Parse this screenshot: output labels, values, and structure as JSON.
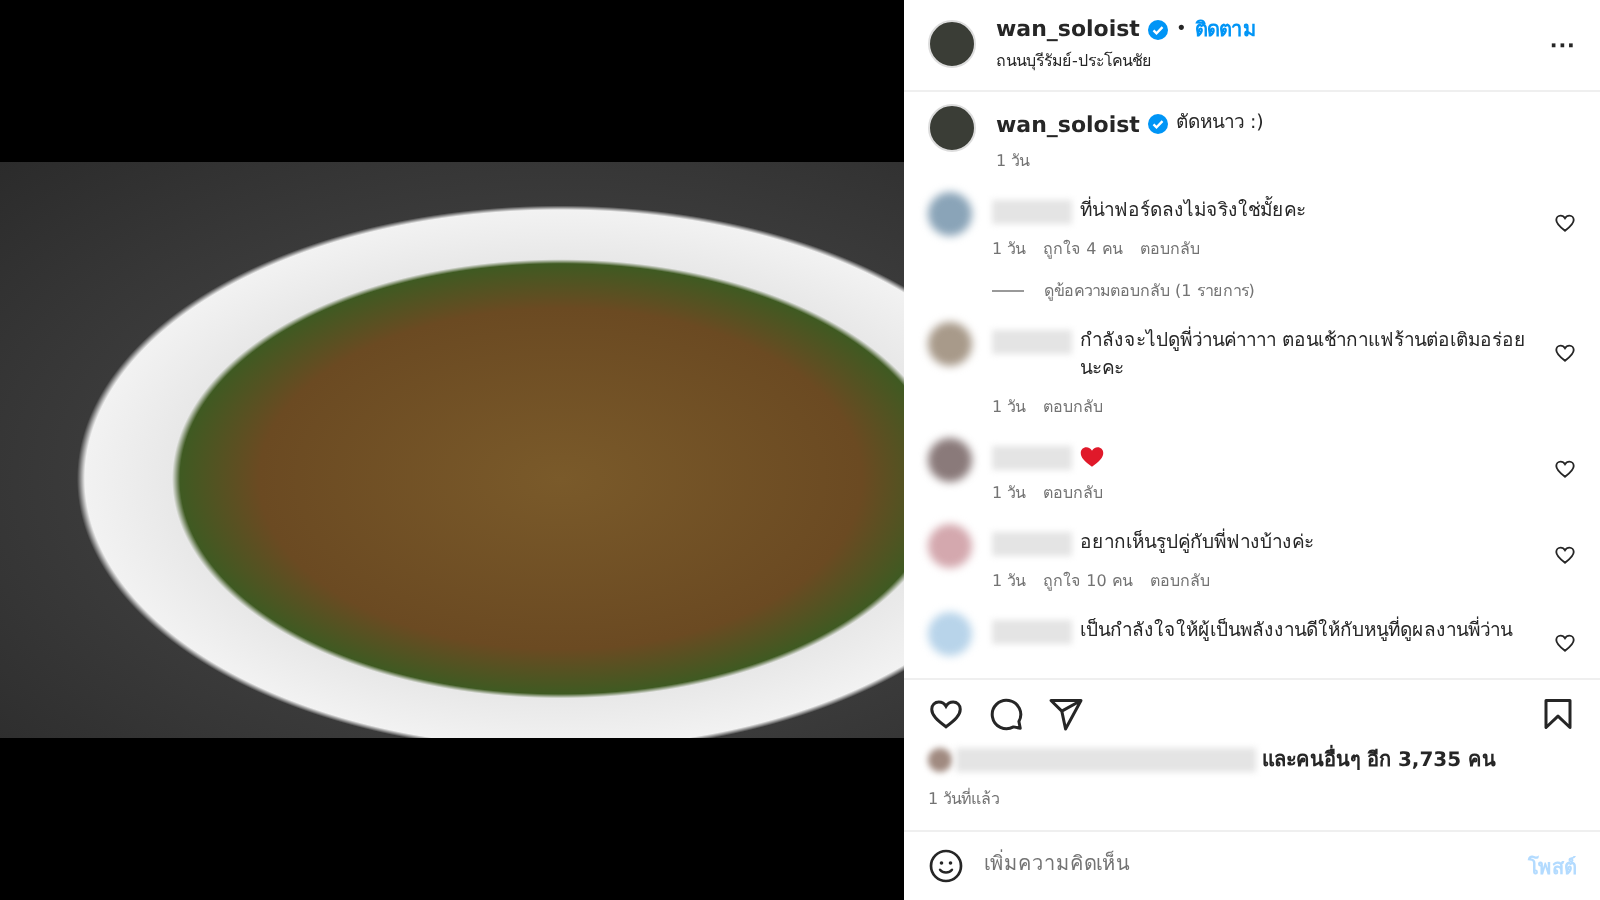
{
  "header": {
    "username": "wan_soloist",
    "verified": true,
    "separator": "•",
    "follow": "ติดตาม",
    "location": "ถนนบุรีรัมย์-ประโคนชัย",
    "more": "···"
  },
  "caption": {
    "username": "wan_soloist",
    "verified": true,
    "text": "ตัดหนาว :)",
    "time": "1 วัน"
  },
  "comments": [
    {
      "kind": "text",
      "color": "#8aa4b8",
      "text": "ที่น่าฟอร์ดลงไม่จริงใช่มั้ยคะ",
      "time": "1 วัน",
      "likes": "ถูกใจ 4 คน",
      "reply": "ตอบกลับ",
      "view_replies": "ดูข้อความตอบกลับ (1 รายการ)"
    },
    {
      "kind": "text",
      "color": "#a89a8a",
      "text": "กำลังจะไปดูพี่ว่านค่าาาา ตอนเช้ากาแฟร้านต่อเติมอร่อยนะคะ",
      "time": "1 วัน",
      "reply": "ตอบกลับ"
    },
    {
      "kind": "heart",
      "color": "#8a7a7a",
      "time": "1 วัน",
      "reply": "ตอบกลับ"
    },
    {
      "kind": "text",
      "color": "#d4a8ae",
      "text": "อยากเห็นรูปคู่กับพี่ฟางบ้างค่ะ",
      "time": "1 วัน",
      "likes": "ถูกใจ 10 คน",
      "reply": "ตอบกลับ"
    },
    {
      "kind": "text",
      "color": "#b8d4ea",
      "text": "เป็นกำลังใจให้ผู้เป็นพลังงานดีให้กับหนูที่ดูผลงานพี่ว่าน"
    }
  ],
  "likes_text": "และคนอื่นๆ อีก 3,735 คน",
  "posted": "1 วันที่แล้ว",
  "add_comment": {
    "placeholder": "เพิ่มความคิดเห็น",
    "post": "โพสต์"
  }
}
